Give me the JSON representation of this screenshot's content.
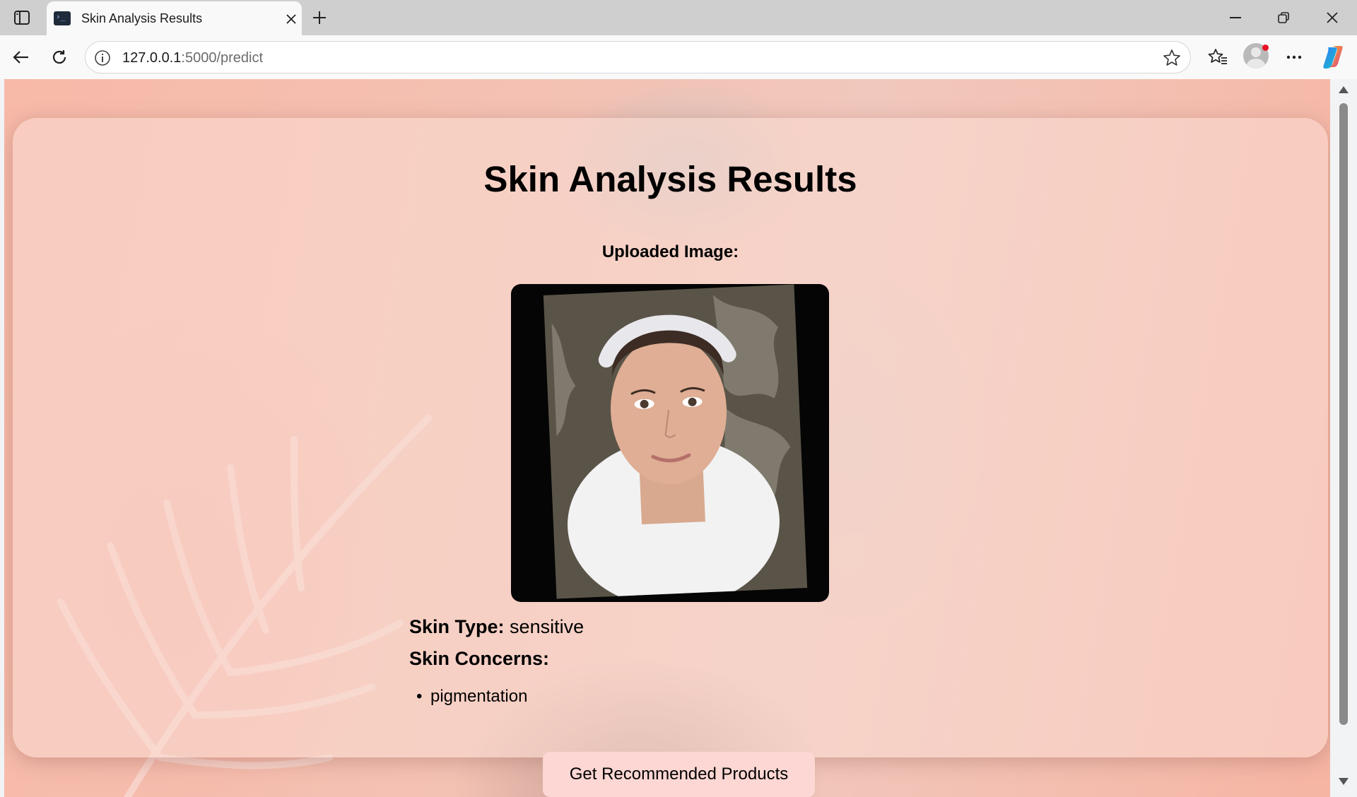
{
  "browser": {
    "tab_title": "Skin Analysis Results",
    "url_host": "127.0.0.1",
    "url_path": ":5000/predict"
  },
  "page": {
    "title": "Skin Analysis Results",
    "uploaded_label": "Uploaded Image:",
    "skin_type_label": "Skin Type:",
    "skin_type_value": "sensitive",
    "concerns_label": "Skin Concerns:",
    "concerns": [
      "pigmentation"
    ],
    "button_label": "Get Recommended Products"
  },
  "colors": {
    "background_tint": "#f7b9a8",
    "button_bg": "#fcd7d3"
  },
  "icons": {
    "tab_favicon": "terminal-icon",
    "info": "info-icon",
    "favorite": "star-icon"
  }
}
